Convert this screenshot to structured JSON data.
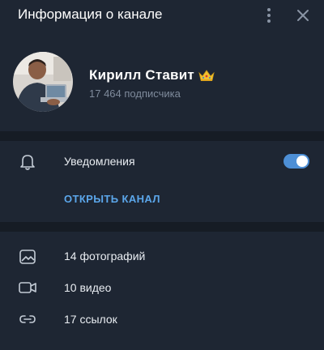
{
  "header": {
    "title": "Информация о канале"
  },
  "channel": {
    "name": "Кирилл Ставит",
    "badge_icon": "crown-emoji",
    "subscribers": "17 464 подписчика"
  },
  "notifications": {
    "label": "Уведомления",
    "enabled": true
  },
  "open_channel_label": "ОТКРЫТЬ КАНАЛ",
  "media": [
    {
      "icon": "photo-icon",
      "label": "14 фотографий"
    },
    {
      "icon": "video-icon",
      "label": "10 видео"
    },
    {
      "icon": "link-icon",
      "label": "17 ссылок"
    }
  ],
  "colors": {
    "background": "#1b2330",
    "panel": "#1e2633",
    "accent": "#5ba6ea",
    "toggle": "#4d8fd6",
    "muted_text": "#7f8b9c"
  }
}
